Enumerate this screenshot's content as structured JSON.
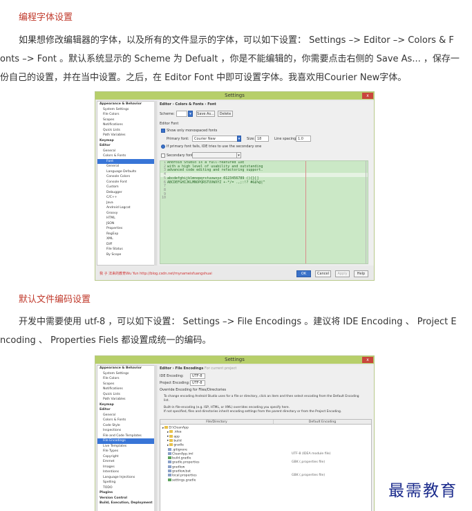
{
  "article": {
    "section1_heading": "编程字体设置",
    "section1_line1": "如果想修改编辑器的字体，以及所有的文件显示的字体，可以如下设置： Settings –> Editor –> Colors & F",
    "section1_line2": "onts –> Font 。默认系统显示的 Scheme 为 Defualt ，你是不能编辑的，你需要点击右侧的 Save As... ，保存一",
    "section1_line3": "份自己的设置，并在当中设置。之后，在 Editor Font 中即可设置字体。我喜欢用Courier New字体。",
    "section2_heading": "默认文件编码设置",
    "section2_line1": "开发中需要使用 utf-8 ，可以如下设置： Settings –> File Encodings 。建议将 IDE Encoding 、 Project E",
    "section2_line2": "ncoding 、 Properties Fiels 都设置成统一的编码。"
  },
  "screenshot1": {
    "title": "Settings",
    "close": "x",
    "search_placeholder": "",
    "tree": [
      {
        "label": "Appearance & Behavior",
        "depth": 1,
        "bold": true
      },
      {
        "label": "System Settings",
        "depth": 2
      },
      {
        "label": "File Colors",
        "depth": 2
      },
      {
        "label": "Scopes",
        "depth": 2
      },
      {
        "label": "Notifications",
        "depth": 2
      },
      {
        "label": "Quick Lists",
        "depth": 2
      },
      {
        "label": "Path Variables",
        "depth": 2
      },
      {
        "label": "Keymap",
        "depth": 1,
        "bold": true
      },
      {
        "label": "Editor",
        "depth": 1,
        "bold": true
      },
      {
        "label": "General",
        "depth": 2
      },
      {
        "label": "Colors & Fonts",
        "depth": 2
      },
      {
        "label": "Font",
        "depth": 3,
        "selected": true
      },
      {
        "label": "General",
        "depth": 3
      },
      {
        "label": "Language Defaults",
        "depth": 3
      },
      {
        "label": "Console Colors",
        "depth": 3
      },
      {
        "label": "Console Font",
        "depth": 3
      },
      {
        "label": "Custom",
        "depth": 3
      },
      {
        "label": "Debugger",
        "depth": 3
      },
      {
        "label": "C/C++",
        "depth": 3
      },
      {
        "label": "Java",
        "depth": 3
      },
      {
        "label": "Android Logcat",
        "depth": 3
      },
      {
        "label": "Groovy",
        "depth": 3
      },
      {
        "label": "HTML",
        "depth": 3
      },
      {
        "label": "JSON",
        "depth": 3
      },
      {
        "label": "Properties",
        "depth": 3
      },
      {
        "label": "RegExp",
        "depth": 3
      },
      {
        "label": "XML",
        "depth": 3
      },
      {
        "label": "Diff",
        "depth": 3
      },
      {
        "label": "File Status",
        "depth": 3
      },
      {
        "label": "By Scope",
        "depth": 3
      }
    ],
    "breadcrumb": "Editor › Colors & Fonts › Font",
    "scheme_label": "Scheme:",
    "scheme_value": "",
    "save_as": "Save As...",
    "delete": "Delete",
    "editor_font_label": "Editor Font",
    "show_monospaced": "Show only monospaced fonts",
    "primary_font_label": "Primary font:",
    "primary_font_value": "Courier New",
    "size_label": "Size:",
    "size_value": "18",
    "line_spacing_label": "Line spacing:",
    "line_spacing_value": "1.0",
    "fallback_note": "If primary font fails, IDE tries to use the secondary one",
    "secondary_font_label": "Secondary font:",
    "line_numbers": [
      "1",
      "2",
      "3",
      "4",
      "5",
      "6",
      "7",
      "8",
      "9",
      "10"
    ],
    "code_lines": [
      "Android Studio is a full-featured IDE",
      "with a high level of usability and outstanding",
      "advanced code editing and refactoring support.",
      "",
      "abcdefghijklmnopqrstuvwxyz 0123456789 (){}[]",
      "ABCDEFGHIJKLMNOPQRSTUVWXYZ +-*/= .,;:!? #&$%@|^",
      "",
      "",
      "",
      ""
    ],
    "watermark": "我 子 法来的教育Wu Yun http://blog.csdn.net/mynameisfuangshuai",
    "ok": "OK",
    "cancel": "Cancel",
    "apply": "Apply",
    "help": "Help"
  },
  "screenshot2": {
    "title": "Settings",
    "close": "x",
    "tree": [
      {
        "label": "Appearance & Behavior",
        "depth": 1,
        "bold": true
      },
      {
        "label": "System Settings",
        "depth": 2
      },
      {
        "label": "File Colors",
        "depth": 2
      },
      {
        "label": "Scopes",
        "depth": 2
      },
      {
        "label": "Notifications",
        "depth": 2
      },
      {
        "label": "Quick Lists",
        "depth": 2
      },
      {
        "label": "Path Variables",
        "depth": 2
      },
      {
        "label": "Keymap",
        "depth": 1,
        "bold": true
      },
      {
        "label": "Editor",
        "depth": 1,
        "bold": true
      },
      {
        "label": "General",
        "depth": 2
      },
      {
        "label": "Colors & Fonts",
        "depth": 2
      },
      {
        "label": "Code Style",
        "depth": 2
      },
      {
        "label": "Inspections",
        "depth": 2
      },
      {
        "label": "File and Code Templates",
        "depth": 2
      },
      {
        "label": "File Encodings",
        "depth": 2,
        "selected": true
      },
      {
        "label": "Live Templates",
        "depth": 2
      },
      {
        "label": "File Types",
        "depth": 2
      },
      {
        "label": "Copyright",
        "depth": 2
      },
      {
        "label": "Emmet",
        "depth": 2
      },
      {
        "label": "Images",
        "depth": 2
      },
      {
        "label": "Intentions",
        "depth": 2
      },
      {
        "label": "Language Injections",
        "depth": 2
      },
      {
        "label": "Spelling",
        "depth": 2
      },
      {
        "label": "TODO",
        "depth": 2
      },
      {
        "label": "Plugins",
        "depth": 1,
        "bold": true
      },
      {
        "label": "Version Control",
        "depth": 1,
        "bold": true
      },
      {
        "label": "Build, Execution, Deployment",
        "depth": 1,
        "bold": true
      }
    ],
    "breadcrumb": "Editor › File Encodings",
    "breadcrumb_note": "For current project",
    "ide_encoding_label": "IDE Encoding:",
    "ide_encoding_value": "UTF-8",
    "project_encoding_label": "Project Encoding:",
    "project_encoding_value": "UTF-8",
    "override_heading": "Override Encoding for Files/Directories",
    "desc1": "To change encoding Android Studio uses for a file or directory, click an item and then select encoding from the Default Encoding",
    "desc1b": "list.",
    "desc2": "Built-in file-encoding (e.g. ISP, HTML, or XML) overrides encoding you specify here.",
    "desc3": "If not specified, files and directories inherit encoding settings from the parent directory or from the Project Encoding.",
    "col_file": "File/Directory",
    "col_enc": "Default Encoding",
    "rows": [
      {
        "label": "D:\\CleanApp",
        "icon": "folder",
        "depth": 0,
        "enc": ""
      },
      {
        "label": ".idea",
        "icon": "folder",
        "depth": 1,
        "enc": ""
      },
      {
        "label": "app",
        "icon": "folder",
        "depth": 1,
        "enc": ""
      },
      {
        "label": "build",
        "icon": "folder",
        "depth": 1,
        "enc": ""
      },
      {
        "label": "gradle",
        "icon": "folder",
        "depth": 1,
        "enc": ""
      },
      {
        "label": ".gitignore",
        "icon": "file",
        "depth": 1,
        "enc": ""
      },
      {
        "label": "CleanApp.iml",
        "icon": "file",
        "depth": 1,
        "enc": "UTF-8 (IDEA module file)"
      },
      {
        "label": "build.gradle",
        "icon": "gradle",
        "depth": 1,
        "enc": ""
      },
      {
        "label": "gradle.properties",
        "icon": "file",
        "depth": 1,
        "enc": "GBK (.properties file)"
      },
      {
        "label": "gradlew",
        "icon": "file",
        "depth": 1,
        "enc": ""
      },
      {
        "label": "gradlew.bat",
        "icon": "file",
        "depth": 1,
        "enc": ""
      },
      {
        "label": "local.properties",
        "icon": "file",
        "depth": 1,
        "enc": "GBK (.properties file)"
      },
      {
        "label": "settings.gradle",
        "icon": "gradle",
        "depth": 1,
        "enc": ""
      }
    ]
  },
  "brand": "最需教育",
  "colors": {
    "heading": "#c0392b",
    "titlebar": "#b7cf6a",
    "editor_bg": "#cbe8c6",
    "selection": "#3875d7",
    "brand": "#1b2b8c"
  }
}
